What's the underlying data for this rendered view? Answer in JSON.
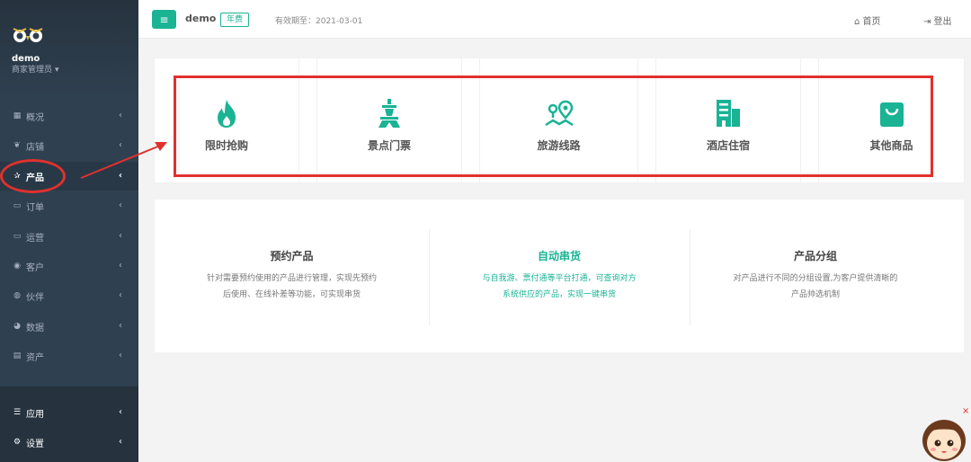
{
  "sidebar": {
    "user_name": "demo",
    "user_role": "商家管理员",
    "items": [
      {
        "label": "概况",
        "icon": "dashboard-icon",
        "glyph": "▦"
      },
      {
        "label": "店铺",
        "icon": "leaf-icon",
        "glyph": "❦"
      },
      {
        "label": "产品",
        "icon": "star-icon",
        "glyph": "✰"
      },
      {
        "label": "订单",
        "icon": "card-icon",
        "glyph": "▭"
      },
      {
        "label": "运营",
        "icon": "monitor-icon",
        "glyph": "▭"
      },
      {
        "label": "客户",
        "icon": "user-circle-icon",
        "glyph": "◉"
      },
      {
        "label": "伙伴",
        "icon": "partner-icon",
        "glyph": "◍"
      },
      {
        "label": "数据",
        "icon": "pie-icon",
        "glyph": "◕"
      },
      {
        "label": "资产",
        "icon": "calculator-icon",
        "glyph": "▤"
      }
    ],
    "bottom_items": [
      {
        "label": "应用",
        "icon": "list-icon",
        "glyph": "☰"
      },
      {
        "label": "设置",
        "icon": "gears-icon",
        "glyph": "⚙"
      }
    ],
    "chevron": "‹"
  },
  "topbar": {
    "menu_glyph": "≡",
    "shop_name": "demo",
    "plan_badge": "年费",
    "expiry": "有效期至：2021-03-01",
    "home_label": "⌂ 首页",
    "logout_label": "⇥ 登出"
  },
  "products": [
    {
      "label": "限时抢购",
      "icon": "fire-icon"
    },
    {
      "label": "景点门票",
      "icon": "tower-icon"
    },
    {
      "label": "旅游线路",
      "icon": "map-route-icon"
    },
    {
      "label": "酒店住宿",
      "icon": "building-icon"
    },
    {
      "label": "其他商品",
      "icon": "shopping-bag-icon"
    }
  ],
  "features": [
    {
      "title": "预约产品",
      "desc1": "针对需要预约使用的产品进行管理，实现先预约",
      "desc2": "后使用、在线补差等功能，可实现串货"
    },
    {
      "title": "自动串货",
      "desc1": "与自我游、票付通等平台打通，可查询对方",
      "desc2": "系统供应的产品，实现一键串货"
    },
    {
      "title": "产品分组",
      "desc1": "对产品进行不同的分组设置,为客户提供清晰的",
      "desc2": "产品帅选机制"
    }
  ],
  "colors": {
    "accent": "#1ab394",
    "sidebar": "#2f4050",
    "annotation": "#e0312d"
  },
  "mascot_close": "×"
}
